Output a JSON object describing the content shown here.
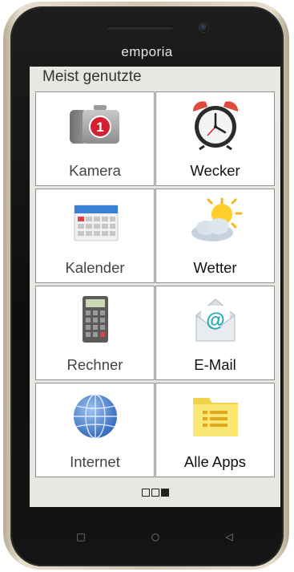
{
  "device": {
    "brand": "emporia"
  },
  "home": {
    "header": "Meist genutzte",
    "tiles": [
      {
        "label": "Kamera",
        "icon": "camera-icon",
        "badge": "1"
      },
      {
        "label": "Wecker",
        "icon": "alarm-clock-icon"
      },
      {
        "label": "Kalender",
        "icon": "calendar-icon"
      },
      {
        "label": "Wetter",
        "icon": "weather-sun-cloud-icon"
      },
      {
        "label": "Rechner",
        "icon": "calculator-icon"
      },
      {
        "label": "E-Mail",
        "icon": "email-icon"
      },
      {
        "label": "Internet",
        "icon": "globe-icon"
      },
      {
        "label": "Alle Apps",
        "icon": "folder-list-icon"
      }
    ],
    "pages": {
      "count": 3,
      "active_index": 2
    }
  },
  "nav": {
    "recents_symbol": "□",
    "home_symbol": "○",
    "back_symbol": "◁"
  },
  "colors": {
    "screen_background": "#e9e7e1",
    "tile_border": "#8f8f8f",
    "badge_red": "#d42030",
    "frame_champagne": "#d8cfb9"
  }
}
